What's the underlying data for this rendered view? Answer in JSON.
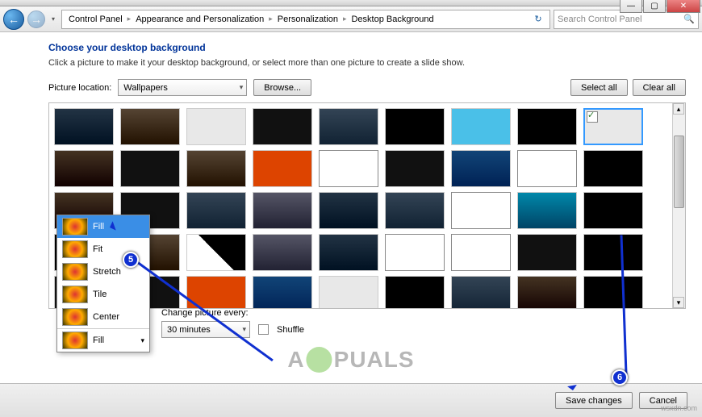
{
  "window": {
    "min_label": "—",
    "max_label": "▢",
    "close_label": "✕"
  },
  "nav": {
    "back_glyph": "←",
    "fwd_glyph": "→"
  },
  "breadcrumb": {
    "items": [
      "Control Panel",
      "Appearance and Personalization",
      "Personalization",
      "Desktop Background"
    ],
    "refresh_glyph": "↻"
  },
  "search": {
    "placeholder": "Search Control Panel",
    "icon": "🔍"
  },
  "page": {
    "heading": "Choose your desktop background",
    "subtext": "Click a picture to make it your desktop background, or select more than one picture to create a slide show."
  },
  "location": {
    "label": "Picture location:",
    "value": "Wallpapers",
    "browse": "Browse..."
  },
  "buttons": {
    "select_all": "Select all",
    "clear_all": "Clear all",
    "save": "Save changes",
    "cancel": "Cancel"
  },
  "position_menu": {
    "items": [
      "Fill",
      "Fit",
      "Stretch",
      "Tile",
      "Center"
    ],
    "selected": "Fill"
  },
  "change_every": {
    "label": "Change picture every:",
    "value": "30 minutes",
    "shuffle": "Shuffle"
  },
  "annotations": {
    "step5": "5",
    "step6": "6"
  },
  "watermark": {
    "text_left": "A",
    "text_right": "PUALS"
  },
  "credit": "wsxdn.com"
}
